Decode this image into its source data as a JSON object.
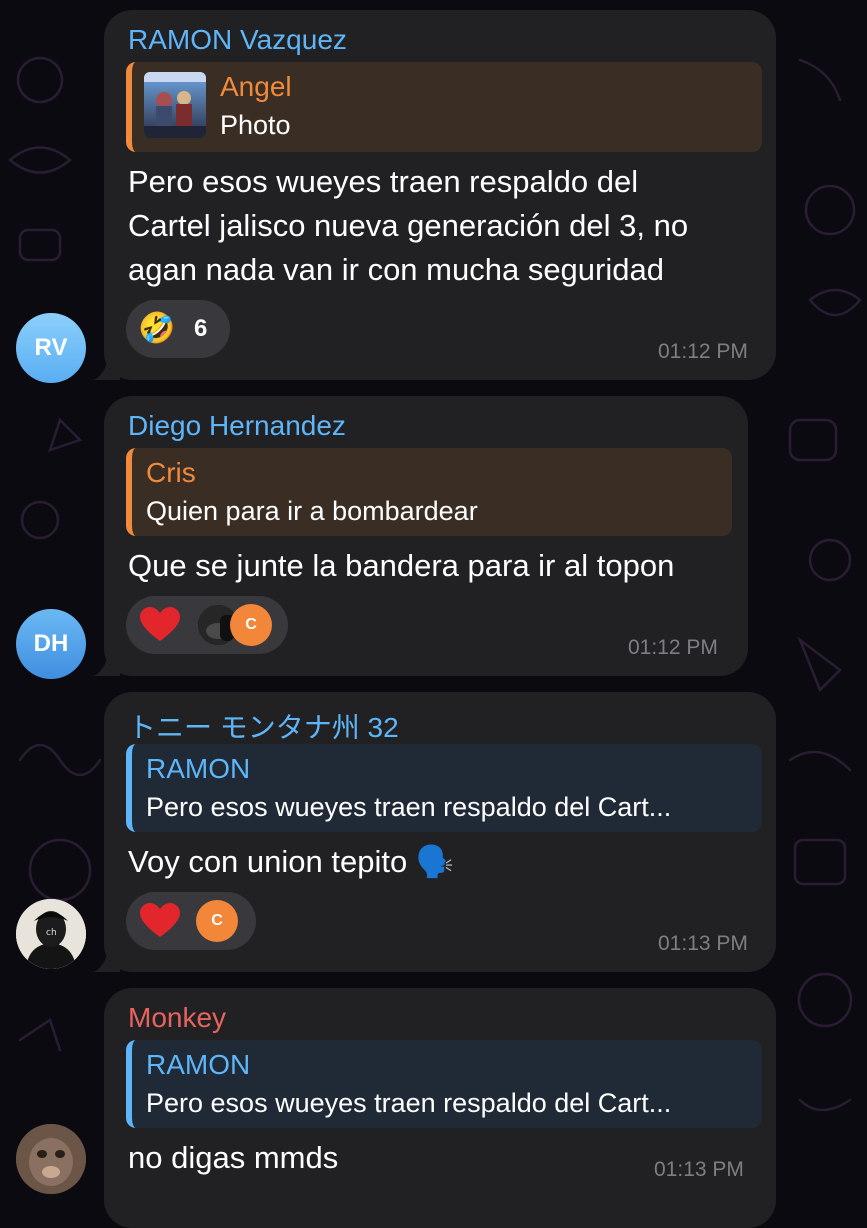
{
  "messages": [
    {
      "sender": "RAMON Vazquez",
      "sender_color": "#5eb5f7",
      "avatar_initials": "RV",
      "reply": {
        "name": "Angel",
        "text": "Photo",
        "accent": "#f08a3c",
        "has_thumbnail": true
      },
      "lines": [
        "Pero esos wueyes traen respaldo del",
        "Cartel jalisco nueva generación del 3, no",
        "agan nada van ir con mucha seguridad"
      ],
      "reactions": {
        "emoji": "🤣",
        "count": "6"
      },
      "time": "01:12 PM"
    },
    {
      "sender": "Diego Hernandez",
      "sender_color": "#5eb5f7",
      "avatar_initials": "DH",
      "reply": {
        "name": "Cris",
        "text": "Quien para ir a bombardear",
        "accent": "#f08a3c"
      },
      "lines": [
        "Que se junte la bandera para ir al topon"
      ],
      "reactions": {
        "emoji": "heart-icon",
        "user_initial": "C"
      },
      "time": "01:12 PM"
    },
    {
      "sender": "トニー モンタナ州 32",
      "sender_color": "#5eb5f7",
      "reply": {
        "name": "RAMON",
        "text": "Pero esos wueyes traen respaldo del Cart...",
        "accent": "#5eb5f7"
      },
      "lines": [
        "Voy con union tepito 🗣️"
      ],
      "reactions": {
        "emoji": "heart-icon",
        "user_initial": "C"
      },
      "time": "01:13 PM"
    },
    {
      "sender": "Monkey",
      "sender_color": "#e5645f",
      "reply": {
        "name": "RAMON",
        "text": "Pero esos wueyes traen respaldo del Cart...",
        "accent": "#5eb5f7"
      },
      "lines": [
        "no digas mmds"
      ],
      "time": "01:13 PM"
    }
  ],
  "colors": {
    "background": "#0b0a10",
    "bubble": "#212123",
    "reaction_pill": "#39393d",
    "timestamp": "#7d7d84"
  }
}
